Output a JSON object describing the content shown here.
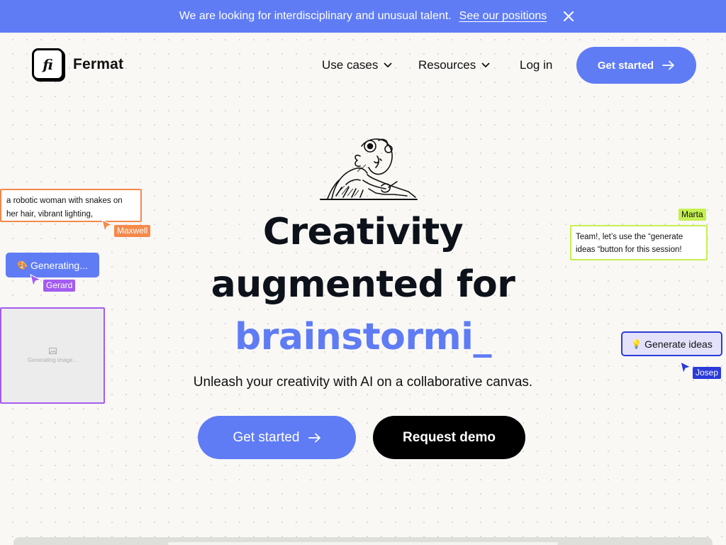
{
  "announcement": {
    "text": "We are looking for interdisciplinary and unusual talent.",
    "link_text": "See our positions",
    "close_icon": "close-icon"
  },
  "header": {
    "logo_glyph": "fi",
    "brand": "Fermat",
    "nav": [
      {
        "label": "Use cases",
        "has_dropdown": true
      },
      {
        "label": "Resources",
        "has_dropdown": true
      },
      {
        "label": "Log in",
        "has_dropdown": false
      }
    ],
    "cta_label": "Get started"
  },
  "hero": {
    "headline_line1": "Creativity",
    "headline_line2": "augmented for",
    "headline_typed": "brainstormi_",
    "subtitle": "Unleash your creativity with AI on a collaborative canvas.",
    "primary_button": "Get started",
    "secondary_button": "Request demo"
  },
  "canvas": {
    "prompt_card_text": "a robotic woman with snakes on her hair, vibrant lighting,",
    "maxwell_tag": "Maxwell",
    "generating_button": "Generating...",
    "generating_emoji": "🎨",
    "gerard_tag": "Gerard",
    "image_placeholder": "Generating image...",
    "marta_tag": "Marta",
    "marta_card_text": "Team!, let’s use the “generate ideas “button for this session!",
    "ideas_button": "Generate ideas",
    "ideas_emoji": "💡",
    "josep_tag": "Josep"
  },
  "colors": {
    "accent": "#5f7cf5",
    "maxwell": "#f5894a",
    "gerard": "#a35cf0",
    "marta": "#c4f050",
    "josep": "#2b3bd8",
    "background": "#f9f8f5"
  }
}
